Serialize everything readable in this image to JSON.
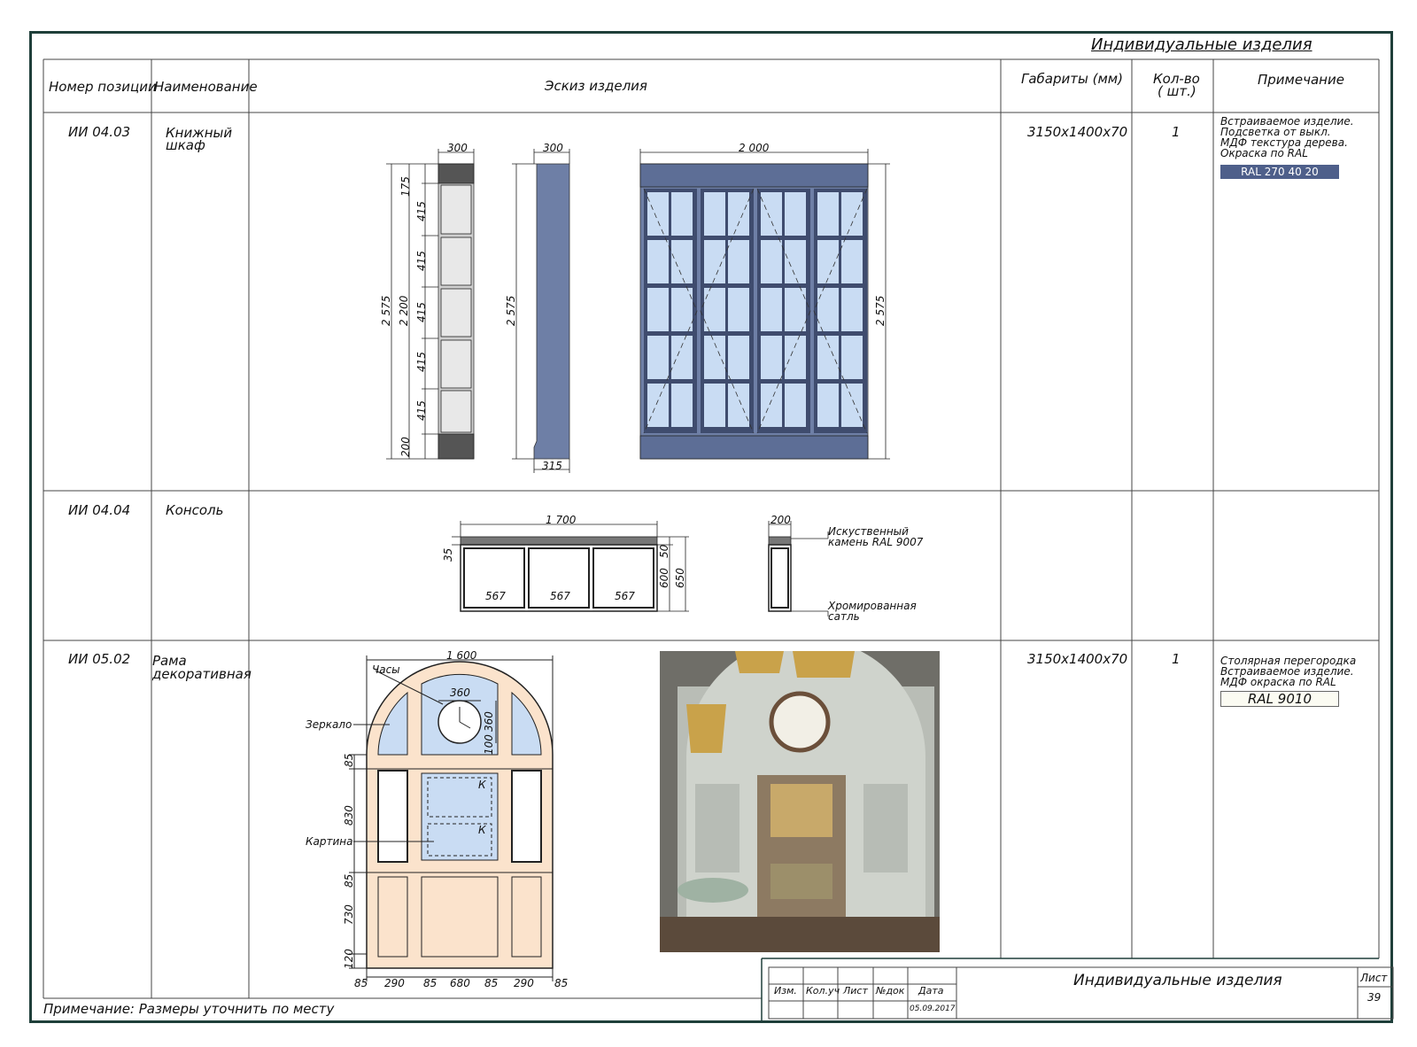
{
  "sheet": {
    "title": "Индивидуальные изделия",
    "footnote": "Примечание: Размеры уточнить по месту"
  },
  "table": {
    "headers": {
      "position": "Номер позиции",
      "name": "Наименование",
      "sketch": "Эскиз изделия",
      "dims": "Габариты (мм)",
      "qty_line1": "Кол-во",
      "qty_line2": "( шт.)",
      "note": "Примечание"
    },
    "rows": [
      {
        "position": "ИИ 04.03",
        "name_line1": "Книжный",
        "name_line2": "шкаф",
        "dims": "3150x1400x70",
        "qty": "1",
        "note_lines": [
          "Встраиваемое изделие.",
          "Подсветка от выкл.",
          "МДФ текстура дерева.",
          "Окраска по RAL"
        ],
        "color_code": "RAL 270 40 20"
      },
      {
        "position": "ИИ 04.04",
        "name_line1": "Консоль",
        "name_line2": "",
        "dims": "",
        "qty": "",
        "note_lines": [],
        "color_code": ""
      },
      {
        "position": "ИИ 05.02",
        "name_line1": "Рама",
        "name_line2": "декоративная",
        "dims": "3150x1400x70",
        "qty": "1",
        "note_lines": [
          "Столярная перегородка",
          "Встраиваемое изделие.",
          "МДФ окраска по RAL"
        ],
        "color_code": "RAL 9010"
      }
    ]
  },
  "drawings": {
    "bookcase": {
      "dim_depth_a": "300",
      "dim_depth_b": "300",
      "dim_width": "2 000",
      "dim_height_total": "2 575",
      "dim_height_inner": "2 200",
      "dim_height_side": "2 575",
      "dim_height_front": "2 575",
      "dim_top": "175",
      "dim_shelf": "415",
      "dim_bottom": "200",
      "dim_base": "315"
    },
    "console": {
      "dim_width": "1 700",
      "dim_top": "35",
      "dim_inner_height": "600",
      "dim_total_height": "650",
      "dim_slab": "50",
      "dim_section": "567",
      "dim_side_depth": "200",
      "callout_stone_line1": "Искуственный",
      "callout_stone_line2": "камень RAL 9007",
      "callout_chrome_line1": "Хромированная",
      "callout_chrome_line2": "сатль"
    },
    "frame": {
      "dim_width": "1 600",
      "dim_clock_w": "360",
      "dim_clock_h": "360",
      "dim_clock_off": "100",
      "dim_v1": "85",
      "dim_v2": "830",
      "dim_v3": "85",
      "dim_v4": "730",
      "dim_v5": "120",
      "dim_h": [
        "85",
        "290",
        "85",
        "680",
        "85",
        "290",
        "85"
      ],
      "label_clock": "Часы",
      "label_mirror": "Зеркало",
      "label_picture": "Картина",
      "mark_k": "К"
    }
  },
  "title_block": {
    "cols": [
      "Изм.",
      "Кол.уч",
      "Лист",
      "№док",
      "Дата"
    ],
    "date": "05.09.2017",
    "title": "Индивидуальные изделия",
    "sheet_label": "Лист",
    "sheet_number": "39"
  },
  "colors": {
    "frame_green": "#1f3f3a",
    "cabinet_blue": "#6e7fa6",
    "glass_blue": "#c9dcf3",
    "peach": "#fbe3cc",
    "ral_badge": "#4e5f8a"
  }
}
